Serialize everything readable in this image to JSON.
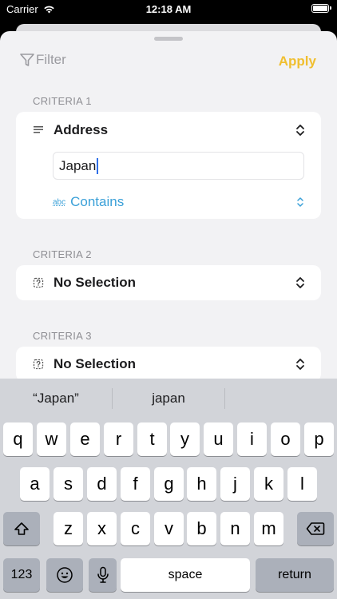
{
  "status_bar": {
    "carrier": "Carrier",
    "time": "12:18 AM"
  },
  "nav": {
    "filter_label": "Filter",
    "apply_label": "Apply"
  },
  "criteria": [
    {
      "label": "CRITERIA 1",
      "field": "Address",
      "value": "Japan",
      "operator": "Contains",
      "operator_icon": "abc"
    },
    {
      "label": "CRITERIA 2",
      "field": "No Selection"
    },
    {
      "label": "CRITERIA 3",
      "field": "No Selection"
    }
  ],
  "keyboard": {
    "suggestions": [
      "“Japan”",
      "japan"
    ],
    "row1": [
      "q",
      "w",
      "e",
      "r",
      "t",
      "y",
      "u",
      "i",
      "o",
      "p"
    ],
    "row2": [
      "a",
      "s",
      "d",
      "f",
      "g",
      "h",
      "j",
      "k",
      "l"
    ],
    "row3": [
      "z",
      "x",
      "c",
      "v",
      "b",
      "n",
      "m"
    ],
    "numbers_label": "123",
    "space_label": "space",
    "return_label": "return"
  },
  "colors": {
    "accent": "#f0bf30",
    "link": "#3aa0d8",
    "caret": "#2f6fe8"
  }
}
